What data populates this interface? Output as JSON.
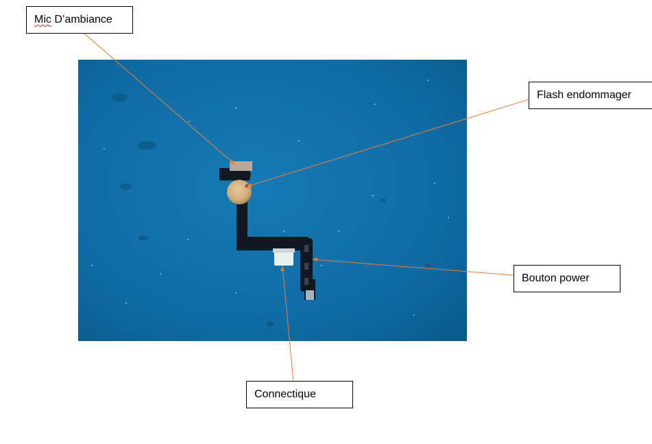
{
  "callouts": {
    "mic": {
      "first_word": "Mic",
      "rest": " D’ambiance"
    },
    "flash": {
      "label": "Flash endommager"
    },
    "power": {
      "label": "Bouton power"
    },
    "connector": {
      "label": "Connectique"
    }
  },
  "colors": {
    "background_blue": "#0f6fa6",
    "leader_line": "#ed7d31",
    "flex_cable": "#121821",
    "mic_module": "#b7a898",
    "flash_module": "#d9b98b",
    "connector": "#e8f1ee"
  }
}
